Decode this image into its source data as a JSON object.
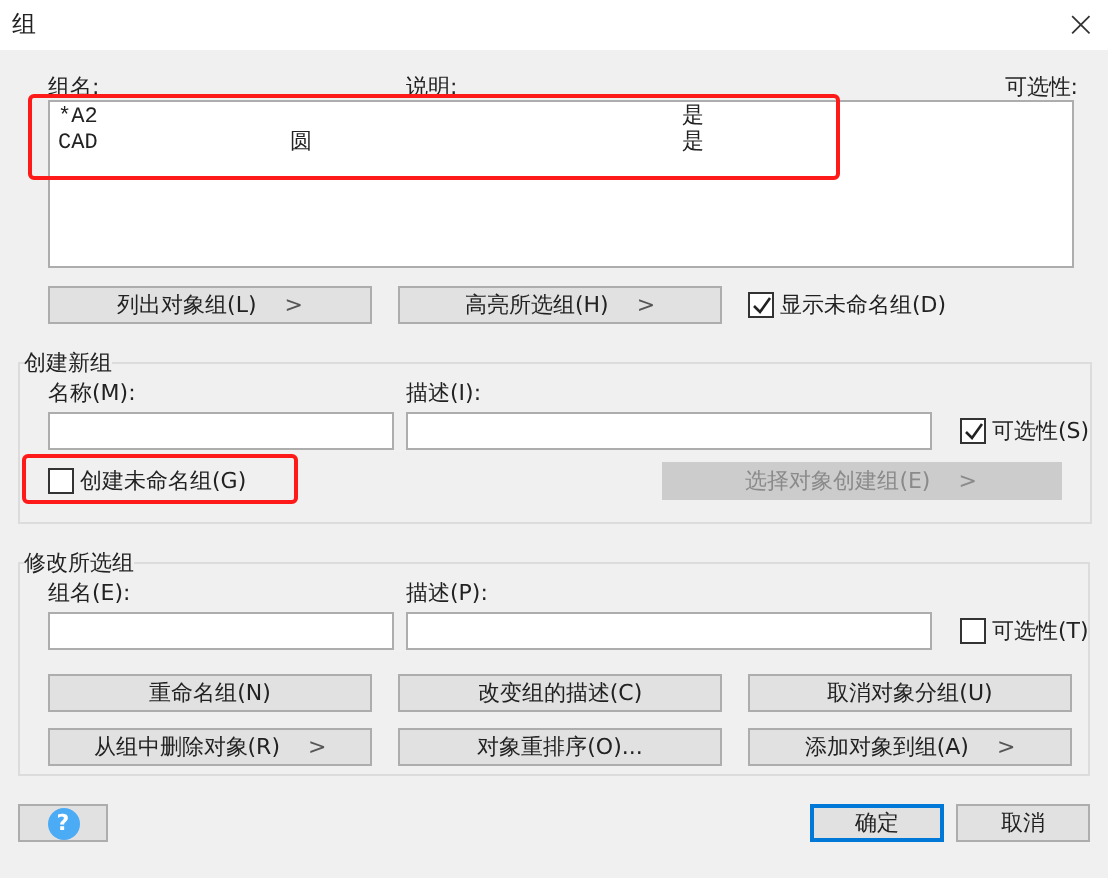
{
  "window": {
    "title": "组",
    "close": "×"
  },
  "list": {
    "columns": [
      "组名:",
      "说明:",
      "可选性:"
    ],
    "rows": [
      {
        "name": "*A2",
        "description": "",
        "selectable": "是"
      },
      {
        "name": "CAD",
        "description": "圆",
        "selectable": "是"
      }
    ],
    "highlighted": true
  },
  "list_buttons": [
    {
      "label": "列出对象组(L)",
      "arrow": ">"
    },
    {
      "label": "高亮所选组(H)",
      "arrow": ">"
    }
  ],
  "show_unnamed": {
    "label": "显示未命名组(D)",
    "checked": true
  },
  "create_group": {
    "title": "创建新组",
    "name_label": "名称(M):",
    "desc_label": "描述(I):",
    "selectable": {
      "label": "可选性(S)",
      "checked": true
    },
    "unnamed": {
      "label": "创建未命名组(G)",
      "checked": false,
      "highlighted": true
    },
    "select_button": {
      "label": "选择对象创建组(E)",
      "arrow": ">",
      "disabled": true
    }
  },
  "modify_group": {
    "title": "修改所选组",
    "name_label": "组名(E):",
    "desc_label": "描述(P):",
    "selectable": {
      "label": "可选性(T)",
      "checked": false
    },
    "buttons": [
      {
        "label": "重命名组(N)"
      },
      {
        "label": "改变组的描述(C)"
      },
      {
        "label": "取消对象分组(U)"
      },
      {
        "label": "从组中删除对象(R)",
        "arrow": ">"
      },
      {
        "label": "对象重排序(O)..."
      },
      {
        "label": "添加对象到组(A)",
        "arrow": ">"
      }
    ]
  },
  "footer": {
    "help": "?",
    "buttons": [
      {
        "label": "确定",
        "default": true
      },
      {
        "label": "取消",
        "default": false
      }
    ]
  }
}
